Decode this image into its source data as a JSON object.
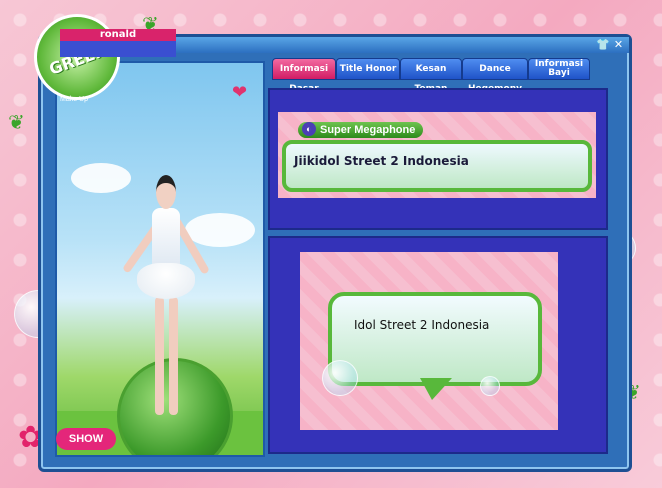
{
  "window": {
    "title_buttons": {
      "shirt": "👕",
      "close": "✕"
    }
  },
  "avatar": {
    "brand": "GREEN",
    "makeup_label": "Make Up",
    "name_label": "ronald",
    "show_button": "SHOW"
  },
  "tabs": [
    {
      "label": "Informasi Dasar",
      "active": true
    },
    {
      "label": "Title Honor",
      "active": false
    },
    {
      "label": "Kesan Teman",
      "active": false
    },
    {
      "label": "Dance Hegemony",
      "active": false
    },
    {
      "label": "Informasi Bayi",
      "active": false
    }
  ],
  "megaphone": {
    "label": "Super Megaphone",
    "message": "Jiikidol Street 2 Indonesia"
  },
  "chat": {
    "message": "Idol Street 2 Indonesia"
  },
  "colors": {
    "window_blue": "#2f6fb8",
    "panel_indigo": "#3432b8",
    "tab_active_pink": "#d21c64",
    "bubble_green": "#58b83b"
  }
}
